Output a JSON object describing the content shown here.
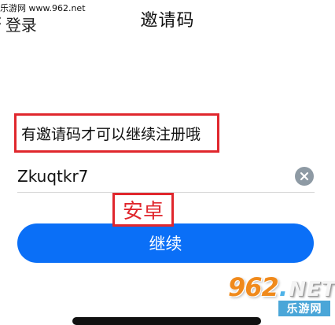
{
  "watermark": {
    "top_text": "乐游网 www.962.net"
  },
  "header": {
    "back_label": "登录",
    "title": "邀请码"
  },
  "instruction": {
    "text": "有邀请码才可以继续注册哦"
  },
  "code_field": {
    "value": "Zkuqtkr7",
    "placeholder": ""
  },
  "annotation": {
    "text": "安卓"
  },
  "continue_button": {
    "label": "继续"
  },
  "logo": {
    "digits": "962",
    "dot": ".",
    "net": "NET",
    "site_name": "乐游网"
  },
  "colors": {
    "accent": "#0a6ff7",
    "highlight_box": "#e0272d",
    "clear_icon": "#8e9aa4",
    "logo_orange": "#f08a1c",
    "logo_blue": "#4aa6d8"
  }
}
